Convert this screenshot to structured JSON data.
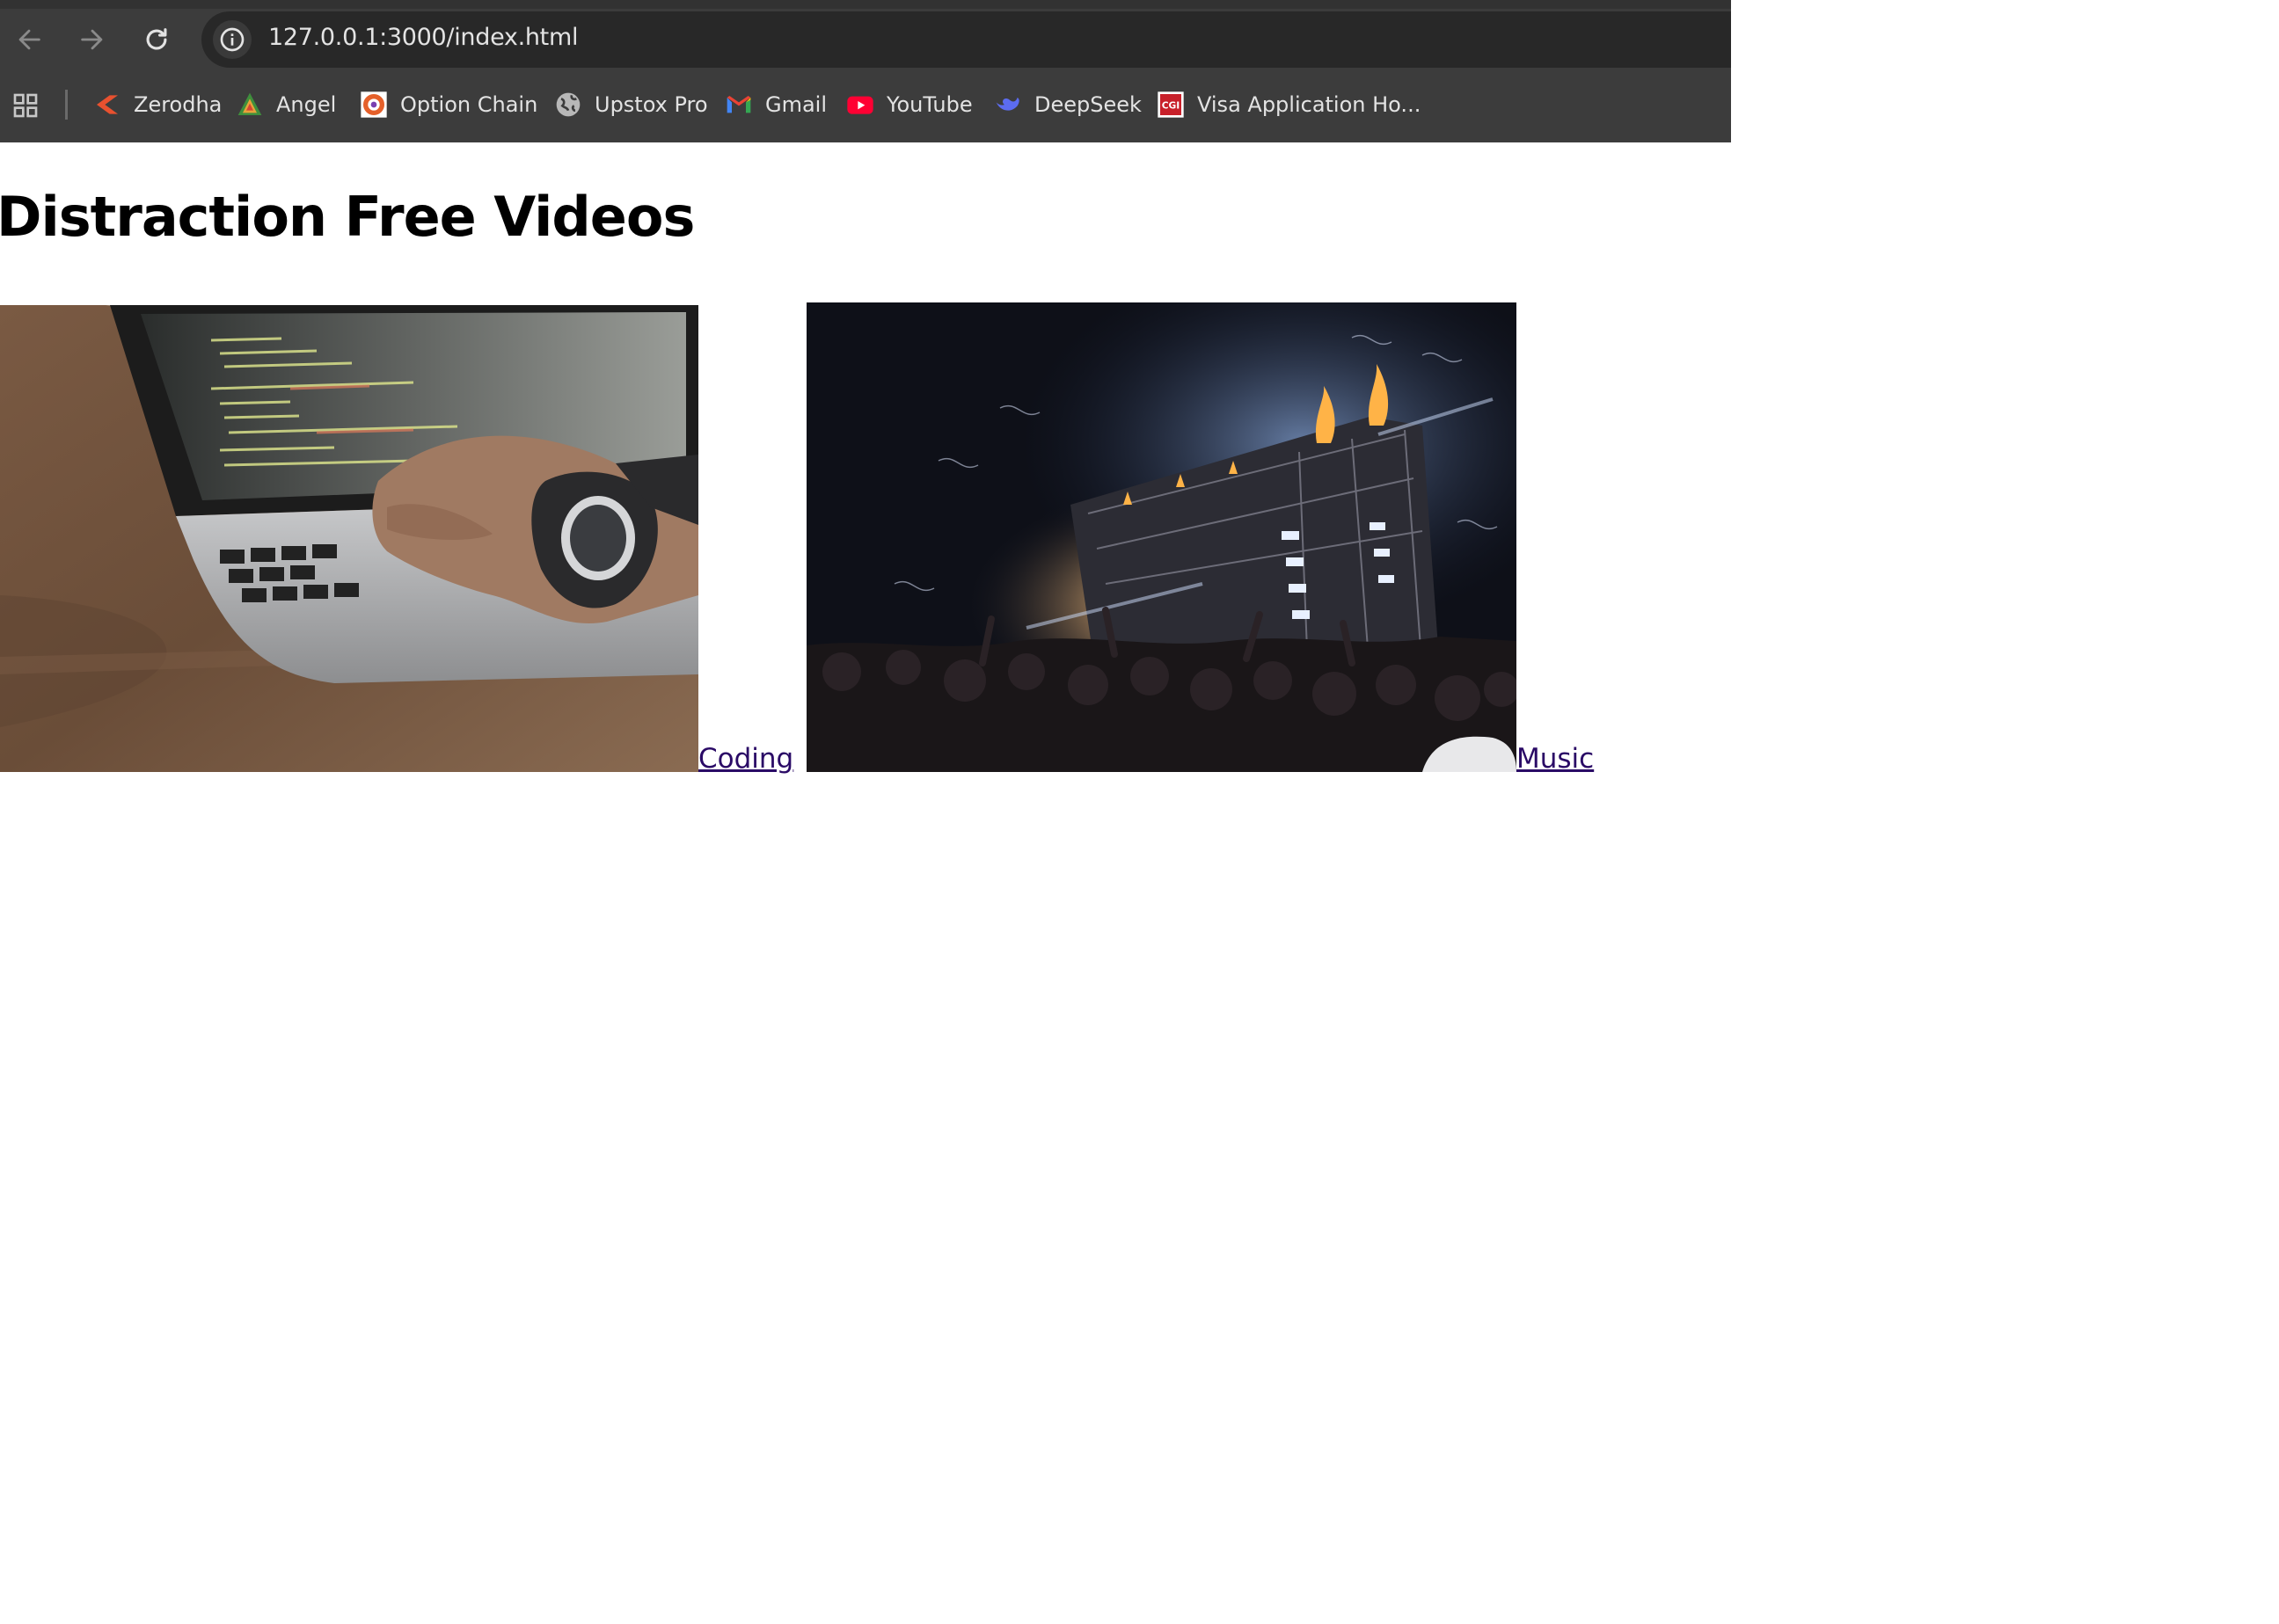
{
  "browser": {
    "url": "127.0.0.1:3000/index.html",
    "bookmarks": [
      {
        "label": "Zerodha",
        "icon": "zerodha-icon"
      },
      {
        "label": "Angel",
        "icon": "angel-icon"
      },
      {
        "label": "Option Chain",
        "icon": "option-chain-icon"
      },
      {
        "label": "Upstox Pro",
        "icon": "globe-icon"
      },
      {
        "label": "Gmail",
        "icon": "gmail-icon"
      },
      {
        "label": "YouTube",
        "icon": "youtube-icon"
      },
      {
        "label": "DeepSeek",
        "icon": "deepseek-icon"
      },
      {
        "label": "Visa Application Ho...",
        "icon": "cgi-icon"
      }
    ],
    "colors": {
      "chrome": "#3c3c3c",
      "omnibox": "#282828",
      "text": "#e3e3e3"
    }
  },
  "page": {
    "title": "Distraction Free Videos",
    "links": [
      {
        "label": " Coding ",
        "image": "laptop-coding-photo"
      },
      {
        "label": " Music",
        "image": "concert-crowd-photo"
      }
    ],
    "colors": {
      "link": "#2a0a66"
    }
  }
}
